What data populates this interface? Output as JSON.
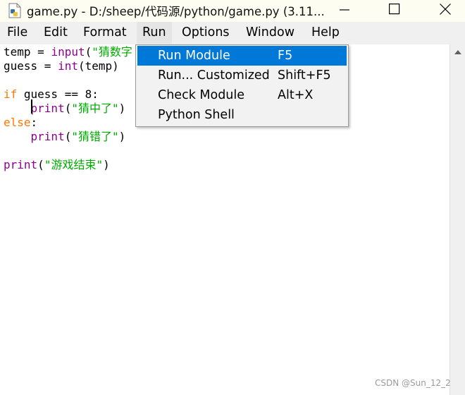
{
  "window": {
    "title": "game.py - D:/sheep/代码源/python/game.py (3.11..."
  },
  "menubar": {
    "items": [
      {
        "label": "File"
      },
      {
        "label": "Edit"
      },
      {
        "label": "Format"
      },
      {
        "label": "Run"
      },
      {
        "label": "Options"
      },
      {
        "label": "Window"
      },
      {
        "label": "Help"
      }
    ],
    "active": "Run"
  },
  "run_menu": {
    "items": [
      {
        "label": "Run Module",
        "shortcut": "F5",
        "highlighted": true
      },
      {
        "label": "Run... Customized",
        "shortcut": "Shift+F5",
        "highlighted": false
      },
      {
        "label": "Check Module",
        "shortcut": "Alt+X",
        "highlighted": false
      },
      {
        "label": "Python Shell",
        "shortcut": "",
        "highlighted": false
      }
    ]
  },
  "editor": {
    "lines": [
      {
        "tokens": [
          [
            "plain",
            "temp = "
          ],
          [
            "bi",
            "input"
          ],
          [
            "plain",
            "("
          ],
          [
            "str",
            "\"猜数字"
          ]
        ]
      },
      {
        "tokens": [
          [
            "plain",
            "guess = "
          ],
          [
            "bi",
            "int"
          ],
          [
            "plain",
            "(temp)"
          ]
        ]
      },
      {
        "tokens": []
      },
      {
        "tokens": [
          [
            "kw",
            "if"
          ],
          [
            "plain",
            " guess == 8:"
          ]
        ]
      },
      {
        "tokens": [
          [
            "plain",
            "    "
          ],
          [
            "bi",
            "print"
          ],
          [
            "plain",
            "("
          ],
          [
            "str",
            "\"猜中了\""
          ],
          [
            "plain",
            ")"
          ]
        ]
      },
      {
        "tokens": [
          [
            "kw",
            "else"
          ],
          [
            "plain",
            ":"
          ]
        ]
      },
      {
        "tokens": [
          [
            "plain",
            "    "
          ],
          [
            "bi",
            "print"
          ],
          [
            "plain",
            "("
          ],
          [
            "str",
            "\"猜错了\""
          ],
          [
            "plain",
            ")"
          ]
        ]
      },
      {
        "tokens": []
      },
      {
        "tokens": [
          [
            "bi",
            "print"
          ],
          [
            "plain",
            "("
          ],
          [
            "str",
            "\"游戏结束\""
          ],
          [
            "plain",
            ")"
          ]
        ]
      }
    ]
  },
  "colors": {
    "keyword": "#ff7700",
    "builtin": "#900090",
    "string": "#00aa00",
    "menu_highlight": "#0078d7"
  },
  "icons": {
    "app": "python-file-icon",
    "minimize": "minimize-icon",
    "maximize": "maximize-icon",
    "close": "close-icon"
  },
  "watermark": "CSDN @Sun_12_2"
}
